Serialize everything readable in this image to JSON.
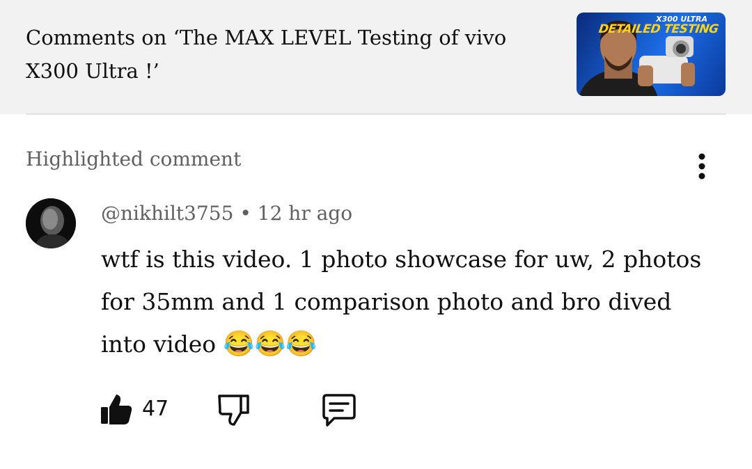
{
  "header": {
    "title": "Comments on ‘The MAX LEVEL Testing of vivo X300 Ultra !’",
    "thumbnail": {
      "overlay_line1": "X300 ULTRA",
      "overlay_line2": "DETAILED TESTING"
    }
  },
  "section": {
    "label": "Highlighted comment",
    "more_icon": "more-vert-icon"
  },
  "comment": {
    "author": "@nikhilt3755",
    "separator": "•",
    "time": "12 hr ago",
    "text": "wtf is this video. 1 photo showcase for uw, 2 photos for 35mm and 1 comparison photo and bro dived into video",
    "emojis": "😂😂😂",
    "likes": "47"
  },
  "actions": {
    "like_icon": "thumbs-up-icon",
    "dislike_icon": "thumbs-down-icon",
    "reply_icon": "comment-reply-icon"
  },
  "colors": {
    "header_bg": "#f2f2f2",
    "text_primary": "#0f0f0f",
    "text_secondary": "#606060",
    "thumb_yellow": "#ffd21a",
    "thumb_blue": "#1c6ee8"
  }
}
